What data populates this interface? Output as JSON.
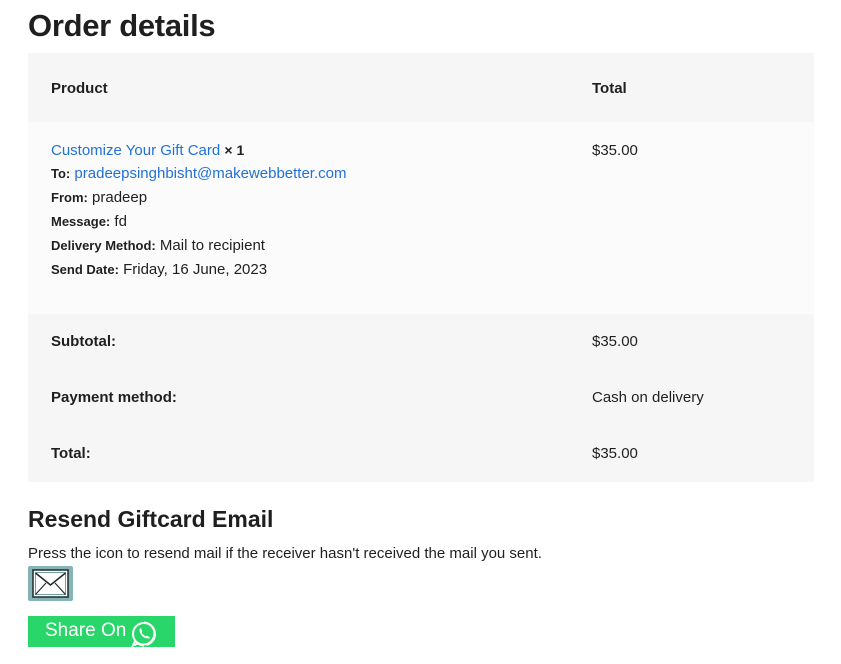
{
  "order": {
    "title": "Order details",
    "headers": {
      "product": "Product",
      "total": "Total"
    },
    "item": {
      "product_link": "Customize Your Gift Card",
      "quantity": "× 1",
      "price": "$35.00",
      "meta": [
        {
          "label": "To:",
          "value": "pradeepsinghbisht@makewebbetter.com",
          "is_link": true
        },
        {
          "label": "From:",
          "value": "pradeep"
        },
        {
          "label": "Message:",
          "value": "fd"
        },
        {
          "label": "Delivery Method:",
          "value": "Mail to recipient"
        },
        {
          "label": "Send Date:",
          "value": "Friday, 16 June, 2023"
        }
      ]
    },
    "totals": [
      {
        "label": "Subtotal:",
        "value": "$35.00"
      },
      {
        "label": "Payment method:",
        "value": "Cash on delivery"
      },
      {
        "label": "Total:",
        "value": "$35.00"
      }
    ]
  },
  "resend": {
    "heading": "Resend Giftcard Email",
    "note": "Press the icon to resend mail if the receiver hasn't received the mail you sent."
  },
  "share": {
    "label": "Share On",
    "icon": "whatsapp-icon"
  },
  "mail_icon": "envelope-icon",
  "colors": {
    "link": "#2271d6",
    "share_bg": "#29d66a",
    "mail_bg": "#86b4b6",
    "table_header_bg": "#f6f6f6"
  }
}
